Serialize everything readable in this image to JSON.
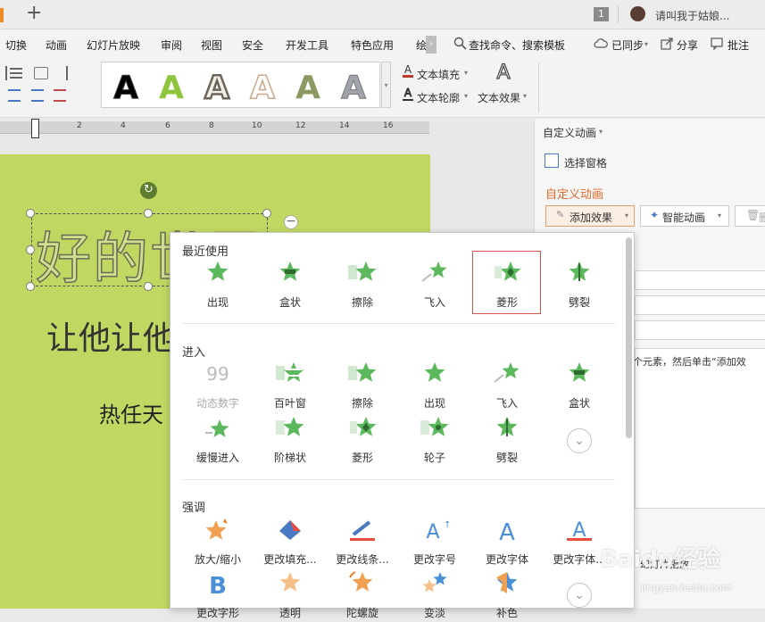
{
  "titlebar": {
    "new_tab_label": "+",
    "page_badge": "1",
    "user_name": "请叫我于姑娘..."
  },
  "tabs": [
    "切换",
    "动画",
    "幻灯片放映",
    "审阅",
    "视图",
    "安全",
    "开发工具",
    "特色应用",
    "绘"
  ],
  "toolbar": {
    "search": "查找命令、搜索模板",
    "sync": "已同步",
    "share": "分享",
    "comment": "批注"
  },
  "ribbon": {
    "wordart_letter": "A",
    "text_fill": "文本填充",
    "text_outline": "文本轮廓",
    "text_effect": "文本效果"
  },
  "ruler": {
    "marks": [
      "2",
      "4",
      "6",
      "8",
      "10",
      "12",
      "14",
      "16"
    ]
  },
  "slide": {
    "title_text": "好的世界",
    "line2_text": "让他让他",
    "line3_text": "热任天"
  },
  "panel": {
    "header": "自定义动画",
    "select_pane": "选择窗格",
    "section_title": "自定义动画",
    "add_effect": "添加效果",
    "smart_anim": "智能动画",
    "delete": "删",
    "hint": "个元素，然后单击“添加效",
    "bottom_link": "幻灯片播放"
  },
  "dropdown": {
    "recent_title": "最近使用",
    "recent": [
      {
        "label": "出现",
        "icon": "star-icon"
      },
      {
        "label": "盒状",
        "icon": "box-star-icon"
      },
      {
        "label": "擦除",
        "icon": "wipe-star-icon"
      },
      {
        "label": "飞入",
        "icon": "fly-star-icon"
      },
      {
        "label": "菱形",
        "icon": "diamond-star-icon"
      },
      {
        "label": "劈裂",
        "icon": "split-star-icon"
      }
    ],
    "enter_title": "进入",
    "enter": [
      {
        "label": "动态数字",
        "icon": "digits-icon"
      },
      {
        "label": "百叶窗",
        "icon": "blinds-star-icon"
      },
      {
        "label": "擦除",
        "icon": "wipe-star-icon"
      },
      {
        "label": "出现",
        "icon": "star-icon"
      },
      {
        "label": "飞入",
        "icon": "fly-star-icon"
      },
      {
        "label": "盒状",
        "icon": "box-star-icon"
      },
      {
        "label": "缓慢进入",
        "icon": "crawl-star-icon"
      },
      {
        "label": "阶梯状",
        "icon": "stairs-star-icon"
      },
      {
        "label": "菱形",
        "icon": "diamond-star-icon"
      },
      {
        "label": "轮子",
        "icon": "wheel-star-icon"
      },
      {
        "label": "劈裂",
        "icon": "split-star-icon"
      }
    ],
    "emph_title": "强调",
    "emph": [
      {
        "label": "放大/缩小",
        "icon": "zoom-star-icon"
      },
      {
        "label": "更改填充...",
        "icon": "fill-color-icon"
      },
      {
        "label": "更改线条...",
        "icon": "line-color-icon"
      },
      {
        "label": "更改字号",
        "icon": "font-size-icon"
      },
      {
        "label": "更改字体",
        "icon": "font-icon"
      },
      {
        "label": "更改字体...",
        "icon": "font-color-icon"
      },
      {
        "label": "更改字形",
        "icon": "bold-icon"
      },
      {
        "label": "透明",
        "icon": "transparent-star-icon"
      },
      {
        "label": "陀螺旋",
        "icon": "spin-star-icon"
      },
      {
        "label": "变淡",
        "icon": "fade-star-icon"
      },
      {
        "label": "补色",
        "icon": "complement-star-icon"
      }
    ]
  },
  "watermark": {
    "brand": "Baidu经验",
    "url": "jingyan.baidu.com"
  }
}
